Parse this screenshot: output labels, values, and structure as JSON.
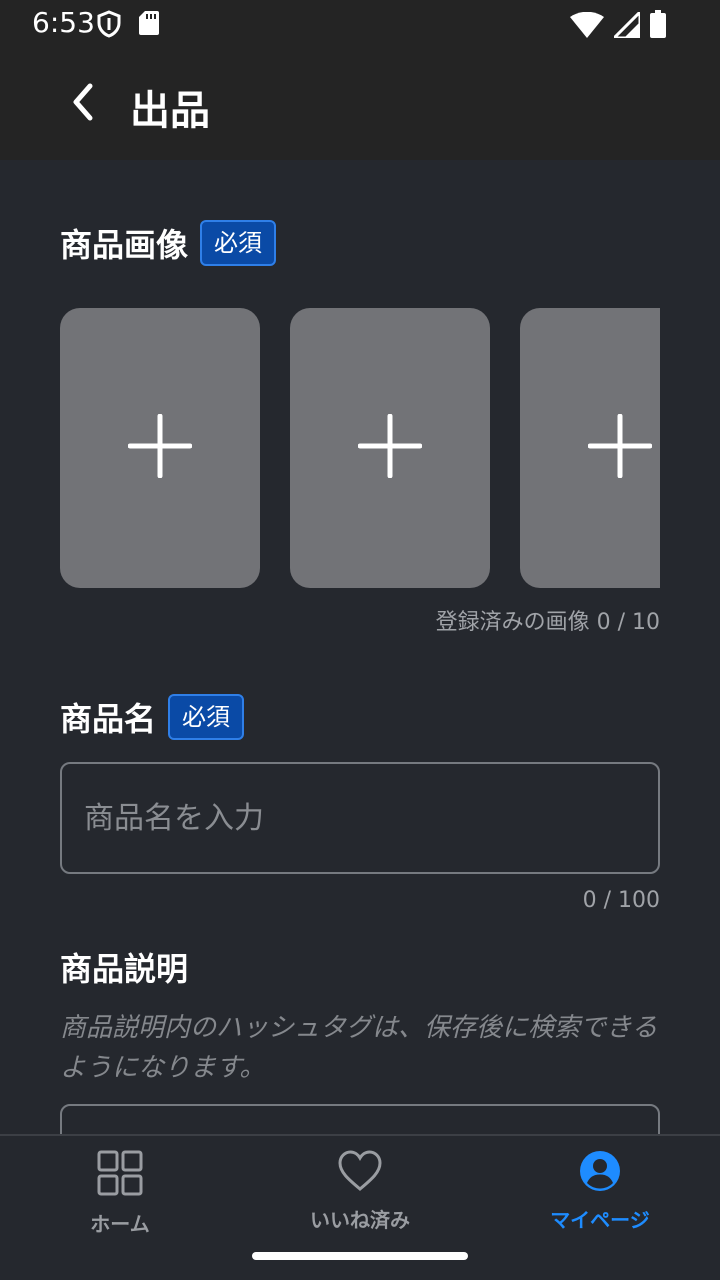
{
  "status_bar": {
    "time": "6:53",
    "icons": [
      "shield-icon",
      "sd-card-icon",
      "wifi-icon",
      "signal-icon",
      "battery-icon"
    ]
  },
  "app_bar": {
    "title": "出品",
    "back_icon": "chevron-left-icon"
  },
  "product_images": {
    "label": "商品画像",
    "required_badge": "必須",
    "slot_icon": "plus-icon",
    "counter": "登録済みの画像 0 / 10"
  },
  "product_name": {
    "label": "商品名",
    "required_badge": "必須",
    "placeholder": "商品名を入力",
    "value": "",
    "counter": "0 / 100"
  },
  "product_description": {
    "label": "商品説明",
    "hint": "商品説明内のハッシュタグは、保存後に検索できるようになります。"
  },
  "bottom_nav": {
    "items": [
      {
        "label": "ホーム",
        "icon": "grid-icon",
        "active": false
      },
      {
        "label": "いいね済み",
        "icon": "heart-icon",
        "active": false
      },
      {
        "label": "マイページ",
        "icon": "account-circle-icon",
        "active": true
      }
    ]
  },
  "colors": {
    "background": "#25282e",
    "app_bar": "#242424",
    "accent": "#1e8cff",
    "badge": "#0a4aa6"
  }
}
